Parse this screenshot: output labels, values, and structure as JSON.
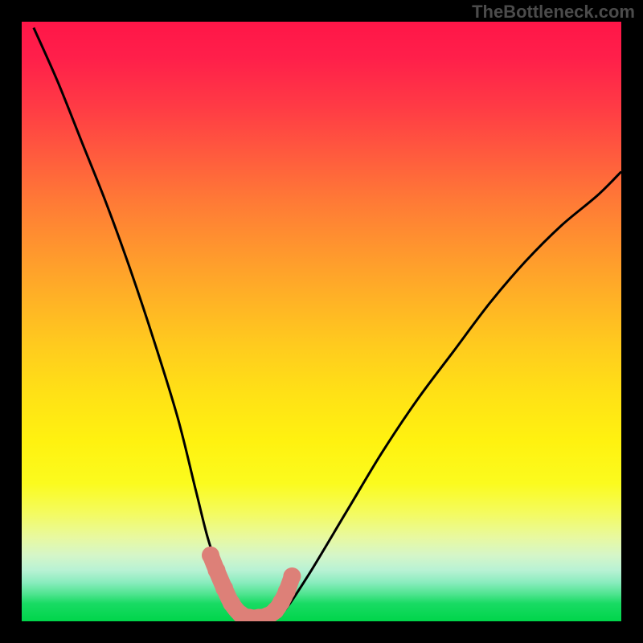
{
  "watermark": {
    "text": "TheBottleneck.com"
  },
  "chart_data": {
    "type": "line",
    "title": "",
    "xlabel": "",
    "ylabel": "",
    "xlim": [
      0,
      100
    ],
    "ylim": [
      0,
      100
    ],
    "series": [
      {
        "name": "bottleneck-curve",
        "x": [
          2,
          6,
          10,
          14,
          18,
          22,
          26,
          29,
          31,
          33,
          34.5,
          36,
          38,
          40,
          42,
          44,
          48,
          54,
          60,
          66,
          72,
          78,
          84,
          90,
          96,
          100
        ],
        "y": [
          99,
          90,
          80,
          70,
          59,
          47,
          34,
          22,
          14,
          8,
          4,
          1.5,
          0.5,
          0.5,
          0.8,
          2,
          8,
          18,
          28,
          37,
          45,
          53,
          60,
          66,
          71,
          75
        ]
      },
      {
        "name": "highlight-markers",
        "x": [
          31.5,
          32.5,
          33.8,
          35,
          36.5,
          38,
          39.5,
          41,
          42.3,
          43.3,
          44.2,
          45.1
        ],
        "y": [
          11,
          8.5,
          5.5,
          3,
          1.2,
          0.6,
          0.6,
          0.9,
          1.8,
          3.2,
          5,
          7.5
        ]
      }
    ],
    "colors": {
      "curve": "#000000",
      "markers": "#dd8078",
      "gradient_top": "#ff1648",
      "gradient_bottom": "#00d54a"
    }
  }
}
